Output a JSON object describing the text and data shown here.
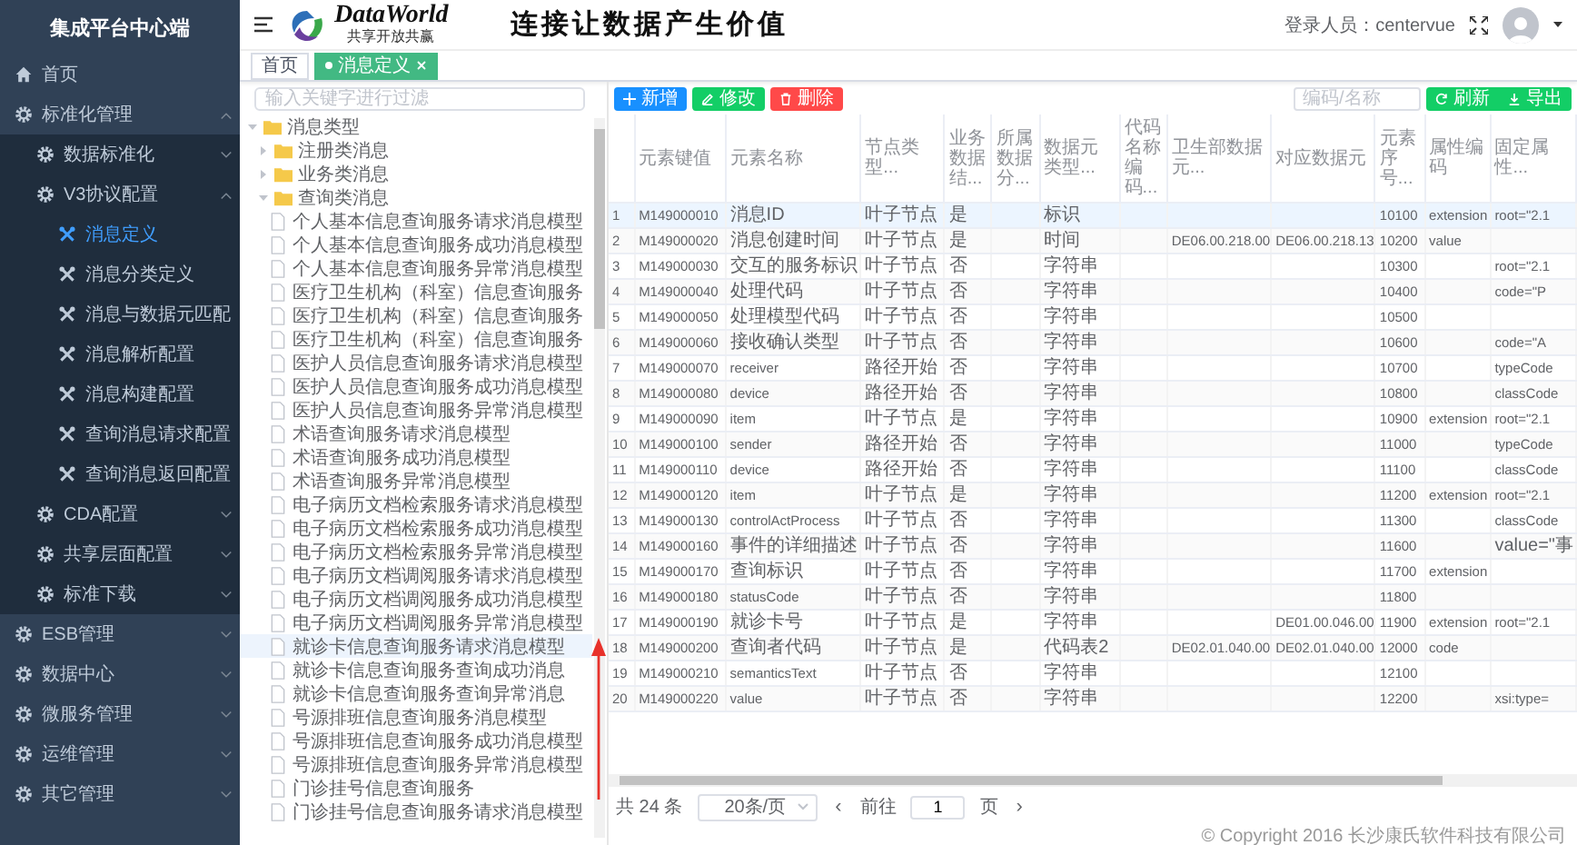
{
  "sidebar": {
    "title": "集成平台中心端",
    "menu": [
      {
        "label": "首页",
        "selected": false
      },
      {
        "label": "标准化管理",
        "expanded": true,
        "children": [
          {
            "label": "数据标准化",
            "expanded": false
          },
          {
            "label": "V3协议配置",
            "expanded": true,
            "children": [
              {
                "label": "消息定义",
                "selected": true
              },
              {
                "label": "消息分类定义",
                "selected": false
              },
              {
                "label": "消息与数据元匹配",
                "selected": false
              },
              {
                "label": "消息解析配置",
                "selected": false
              },
              {
                "label": "消息构建配置",
                "selected": false
              },
              {
                "label": "查询消息请求配置",
                "selected": false
              },
              {
                "label": "查询消息返回配置",
                "selected": false
              }
            ]
          },
          {
            "label": "CDA配置",
            "expanded": false
          },
          {
            "label": "共享层面配置",
            "expanded": false
          },
          {
            "label": "标准下载",
            "expanded": false
          }
        ]
      },
      {
        "label": "ESB管理",
        "expanded": false
      },
      {
        "label": "数据中心",
        "expanded": false
      },
      {
        "label": "微服务管理",
        "expanded": false
      },
      {
        "label": "运维管理",
        "expanded": false
      },
      {
        "label": "其它管理",
        "expanded": false
      }
    ]
  },
  "header": {
    "logo_name": "DataWorld",
    "logo_tagline": "共享开放共赢",
    "slogan": "连接让数据产生价值",
    "user_label": "登录人员：",
    "user_name": "centervue"
  },
  "tabs": [
    {
      "label": "首页",
      "selected": false,
      "closable": false
    },
    {
      "label": "消息定义",
      "selected": true,
      "closable": true
    }
  ],
  "tree": {
    "placeholder": "输入关键字进行过滤",
    "nodes": [
      {
        "label": "消息类型",
        "kind": "folder",
        "expanded": true,
        "children": [
          {
            "label": "注册类消息",
            "kind": "folder",
            "expanded": false
          },
          {
            "label": "业务类消息",
            "kind": "folder",
            "expanded": false
          },
          {
            "label": "查询类消息",
            "kind": "folder",
            "expanded": true,
            "children": [
              {
                "label": "个人基本信息查询服务请求消息模型",
                "kind": "file",
                "selected": false
              },
              {
                "label": "个人基本信息查询服务成功消息模型",
                "kind": "file",
                "selected": false
              },
              {
                "label": "个人基本信息查询服务异常消息模型",
                "kind": "file",
                "selected": false
              },
              {
                "label": "医疗卫生机构（科室）信息查询服务",
                "kind": "file",
                "selected": false
              },
              {
                "label": "医疗卫生机构（科室）信息查询服务",
                "kind": "file",
                "selected": false
              },
              {
                "label": "医疗卫生机构（科室）信息查询服务",
                "kind": "file",
                "selected": false
              },
              {
                "label": "医护人员信息查询服务请求消息模型",
                "kind": "file",
                "selected": false
              },
              {
                "label": "医护人员信息查询服务成功消息模型",
                "kind": "file",
                "selected": false
              },
              {
                "label": "医护人员信息查询服务异常消息模型",
                "kind": "file",
                "selected": false
              },
              {
                "label": "术语查询服务请求消息模型",
                "kind": "file",
                "selected": false
              },
              {
                "label": "术语查询服务成功消息模型",
                "kind": "file",
                "selected": false
              },
              {
                "label": "术语查询服务异常消息模型",
                "kind": "file",
                "selected": false
              },
              {
                "label": "电子病历文档检索服务请求消息模型",
                "kind": "file",
                "selected": false
              },
              {
                "label": "电子病历文档检索服务成功消息模型",
                "kind": "file",
                "selected": false
              },
              {
                "label": "电子病历文档检索服务异常消息模型",
                "kind": "file",
                "selected": false
              },
              {
                "label": "电子病历文档调阅服务请求消息模型",
                "kind": "file",
                "selected": false
              },
              {
                "label": "电子病历文档调阅服务成功消息模型",
                "kind": "file",
                "selected": false
              },
              {
                "label": "电子病历文档调阅服务异常消息模型",
                "kind": "file",
                "selected": false
              },
              {
                "label": "就诊卡信息查询服务请求消息模型",
                "kind": "file",
                "selected": true
              },
              {
                "label": "就诊卡信息查询服务查询成功消息",
                "kind": "file",
                "selected": false
              },
              {
                "label": "就诊卡信息查询服务查询异常消息",
                "kind": "file",
                "selected": false
              },
              {
                "label": "号源排班信息查询服务消息模型",
                "kind": "file",
                "selected": false
              },
              {
                "label": "号源排班信息查询服务成功消息模型",
                "kind": "file",
                "selected": false
              },
              {
                "label": "号源排班信息查询服务异常消息模型",
                "kind": "file",
                "selected": false
              },
              {
                "label": "门诊挂号信息查询服务",
                "kind": "file",
                "selected": false
              },
              {
                "label": "门诊挂号信息查询服务请求消息模型",
                "kind": "file",
                "selected": false
              }
            ]
          }
        ]
      }
    ]
  },
  "toolbar": {
    "buttons": [
      {
        "label": "新增",
        "kind": "add"
      },
      {
        "label": "修改",
        "kind": "edit"
      },
      {
        "label": "删除",
        "kind": "delete"
      }
    ],
    "search": {
      "placeholder": "编码/名称"
    },
    "actions": [
      {
        "label": "刷新",
        "kind": "refresh"
      },
      {
        "label": "导出",
        "kind": "export"
      }
    ]
  },
  "table": {
    "columns": [
      "元素键值",
      "元素名称",
      "节点类型...",
      "业务数据结...",
      "所属数据分...",
      "数据元类型...",
      "代码名称编码...",
      "卫生部数据元...",
      "对应数据元",
      "元素序号...",
      "属性编码",
      "固定属性..."
    ],
    "rows": [
      {
        "index": "1",
        "selected": true,
        "cells": [
          "M149000010",
          "消息ID",
          "叶子节点",
          "是",
          null,
          "标识",
          null,
          null,
          null,
          "10100",
          "extension",
          "root=\"2.1"
        ]
      },
      {
        "index": "2",
        "selected": false,
        "cells": [
          "M149000020",
          "消息创建时间",
          "叶子节点",
          "是",
          null,
          "时间",
          null,
          "DE06.00.218.00",
          "DE06.00.218.13",
          "10200",
          "value",
          null
        ]
      },
      {
        "index": "3",
        "selected": false,
        "cells": [
          "M149000030",
          "交互的服务标识",
          "叶子节点",
          "否",
          null,
          "字符串",
          null,
          null,
          null,
          "10300",
          null,
          "root=\"2.1"
        ]
      },
      {
        "index": "4",
        "selected": false,
        "cells": [
          "M149000040",
          "处理代码",
          "叶子节点",
          "否",
          null,
          "字符串",
          null,
          null,
          null,
          "10400",
          null,
          "code=\"P"
        ]
      },
      {
        "index": "5",
        "selected": false,
        "cells": [
          "M149000050",
          "处理模型代码",
          "叶子节点",
          "否",
          null,
          "字符串",
          null,
          null,
          null,
          "10500",
          null,
          null
        ]
      },
      {
        "index": "6",
        "selected": false,
        "cells": [
          "M149000060",
          "接收确认类型",
          "叶子节点",
          "否",
          null,
          "字符串",
          null,
          null,
          null,
          "10600",
          null,
          "code=\"A"
        ]
      },
      {
        "index": "7",
        "selected": false,
        "cells": [
          "M149000070",
          "receiver",
          "路径开始",
          "否",
          null,
          "字符串",
          null,
          null,
          null,
          "10700",
          null,
          "typeCode"
        ]
      },
      {
        "index": "8",
        "selected": false,
        "cells": [
          "M149000080",
          "device",
          "路径开始",
          "否",
          null,
          "字符串",
          null,
          null,
          null,
          "10800",
          null,
          "classCode"
        ]
      },
      {
        "index": "9",
        "selected": false,
        "cells": [
          "M149000090",
          "item",
          "叶子节点",
          "是",
          null,
          "字符串",
          null,
          null,
          null,
          "10900",
          "extension",
          "root=\"2.1"
        ]
      },
      {
        "index": "10",
        "selected": false,
        "cells": [
          "M149000100",
          "sender",
          "路径开始",
          "否",
          null,
          "字符串",
          null,
          null,
          null,
          "11000",
          null,
          "typeCode"
        ]
      },
      {
        "index": "11",
        "selected": false,
        "cells": [
          "M149000110",
          "device",
          "路径开始",
          "否",
          null,
          "字符串",
          null,
          null,
          null,
          "11100",
          null,
          "classCode"
        ]
      },
      {
        "index": "12",
        "selected": false,
        "cells": [
          "M149000120",
          "item",
          "叶子节点",
          "是",
          null,
          "字符串",
          null,
          null,
          null,
          "11200",
          "extension",
          "root=\"2.1"
        ]
      },
      {
        "index": "13",
        "selected": false,
        "cells": [
          "M149000130",
          "controlActProcess",
          "叶子节点",
          "否",
          null,
          "字符串",
          null,
          null,
          null,
          "11300",
          null,
          "classCode"
        ]
      },
      {
        "index": "14",
        "selected": false,
        "cells": [
          "M149000160",
          "事件的详细描述",
          "叶子节点",
          "否",
          null,
          "字符串",
          null,
          null,
          null,
          "11600",
          null,
          "value=\"事"
        ]
      },
      {
        "index": "15",
        "selected": false,
        "cells": [
          "M149000170",
          "查询标识",
          "叶子节点",
          "否",
          null,
          "字符串",
          null,
          null,
          null,
          "11700",
          "extension",
          null
        ]
      },
      {
        "index": "16",
        "selected": false,
        "cells": [
          "M149000180",
          "statusCode",
          "叶子节点",
          "否",
          null,
          "字符串",
          null,
          null,
          null,
          "11800",
          null,
          null
        ]
      },
      {
        "index": "17",
        "selected": false,
        "cells": [
          "M149000190",
          "就诊卡号",
          "叶子节点",
          "是",
          null,
          "字符串",
          null,
          null,
          "DE01.00.046.00",
          "11900",
          "extension",
          "root=\"2.1"
        ]
      },
      {
        "index": "18",
        "selected": false,
        "cells": [
          "M149000200",
          "查询者代码",
          "叶子节点",
          "是",
          null,
          "代码表2",
          null,
          "DE02.01.040.00",
          "DE02.01.040.00",
          "12000",
          "code",
          null
        ]
      },
      {
        "index": "19",
        "selected": false,
        "cells": [
          "M149000210",
          "semanticsText",
          "叶子节点",
          "否",
          null,
          "字符串",
          null,
          null,
          null,
          "12100",
          null,
          null
        ]
      },
      {
        "index": "20",
        "selected": false,
        "cells": [
          "M149000220",
          "value",
          "叶子节点",
          "否",
          null,
          "字符串",
          null,
          null,
          null,
          "12200",
          null,
          "xsi:type="
        ]
      }
    ]
  },
  "pagination": {
    "total": "共 24 条",
    "page_size": "20条/页",
    "prev": "‹",
    "goto_label": "前往",
    "page": "1",
    "page_unit": "页",
    "next": "›"
  },
  "footer": {
    "copyright": "© Copyright 2016 长沙康氏软件科技有限公司"
  }
}
